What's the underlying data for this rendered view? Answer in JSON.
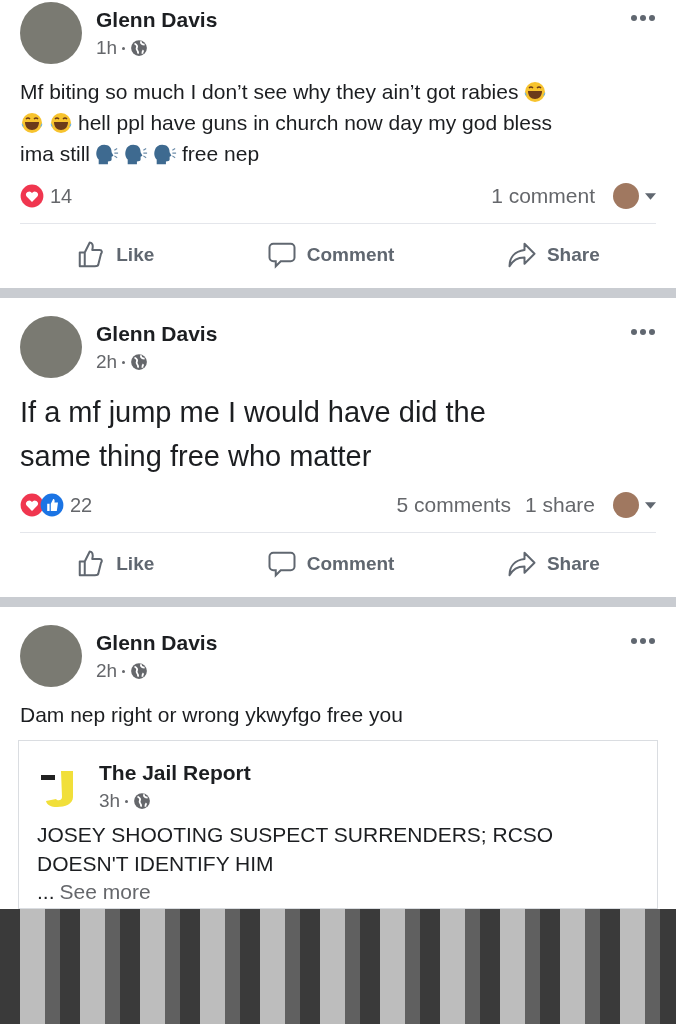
{
  "posts": [
    {
      "author": "Glenn Davis",
      "time": "1h",
      "large": false,
      "body": [
        [
          {
            "kind": "text",
            "text": "Mf biting so much I don’t see why they ain’t got rabies"
          },
          {
            "kind": "laugh"
          }
        ],
        [
          {
            "kind": "laugh"
          },
          {
            "kind": "laugh"
          },
          {
            "kind": "text",
            "text": "hell ppl have guns in church now day my god bless"
          }
        ],
        [
          {
            "kind": "text",
            "text": "ima still"
          },
          {
            "kind": "speak"
          },
          {
            "kind": "speak"
          },
          {
            "kind": "speak"
          },
          {
            "kind": "text",
            "text": "free nep"
          }
        ]
      ],
      "reactions": [
        {
          "kind": "love"
        }
      ],
      "reaction_count": "14",
      "stats": [
        "1 comment"
      ],
      "actions": [
        "Like",
        "Comment",
        "Share"
      ]
    },
    {
      "author": "Glenn Davis",
      "time": "2h",
      "large": true,
      "body": [
        [
          {
            "kind": "text",
            "text": "If a mf jump me I would have did the"
          }
        ],
        [
          {
            "kind": "text",
            "text": "same thing free who matter"
          }
        ]
      ],
      "reactions": [
        {
          "kind": "love"
        },
        {
          "kind": "like"
        }
      ],
      "reaction_count": "22",
      "stats": [
        "5 comments",
        "1 share"
      ],
      "actions": [
        "Like",
        "Comment",
        "Share"
      ]
    },
    {
      "author": "Glenn Davis",
      "time": "2h",
      "large": false,
      "body": [
        [
          {
            "kind": "text",
            "text": "Dam nep right or wrong ykwyfgo  free you"
          }
        ]
      ],
      "shared": {
        "page": "The Jail Report",
        "time": "3h",
        "headline": "JOSEY SHOOTING SUSPECT SURRENDERS; RCSO DOESN'T IDENTIFY HIM",
        "ellipsis": "...",
        "see_more": "See more"
      }
    }
  ]
}
